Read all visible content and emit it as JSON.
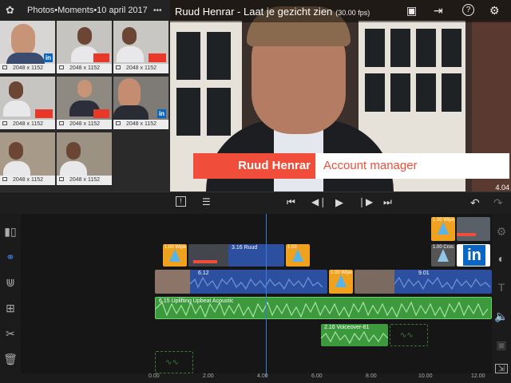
{
  "browser": {
    "title": "Photos•Moments•10 april 2017",
    "thumbs": [
      {
        "size": "2048 x 1152"
      },
      {
        "size": "2048 x 1152"
      },
      {
        "size": "2048 x 1152"
      },
      {
        "size": "2048 x 1152"
      },
      {
        "size": "2048 x 1152"
      },
      {
        "size": "2048 x 1152"
      },
      {
        "size": "2048 x 1152"
      },
      {
        "size": "2048 x 1152"
      }
    ],
    "linkedin_badge": "in"
  },
  "viewer": {
    "title": "Ruud Henrar - Laat je gezicht zien",
    "fps": "(30.00 fps)",
    "lower_third": {
      "name": "Ruud Henrar",
      "role": "Account manager"
    },
    "time": "4.04"
  },
  "timeline": {
    "clips": {
      "wipe1": "1.00  Wipe",
      "title_clip": "3.16  Ruud",
      "wipe2": "1.00",
      "wipe3": "1.00  Wipe",
      "wipe4": "1.00  Wipe",
      "cross": "1.00  Cros",
      "video1": "6.12",
      "wipe5": "1.00  Wipe",
      "video2": "9.01",
      "music": "6.15  Uplifting Upbeat Acoustic",
      "voiceover": "2.16  Voiceover-81",
      "linkedin": "in"
    },
    "ruler": [
      "0.00",
      "2.00",
      "4.00",
      "6.00",
      "8.00",
      "10.00",
      "12.00"
    ]
  },
  "colors": {
    "accent": "#f04e3a",
    "audio": "#3c9a3c",
    "video": "#2d4fa0",
    "transition": "#f0a11e"
  }
}
